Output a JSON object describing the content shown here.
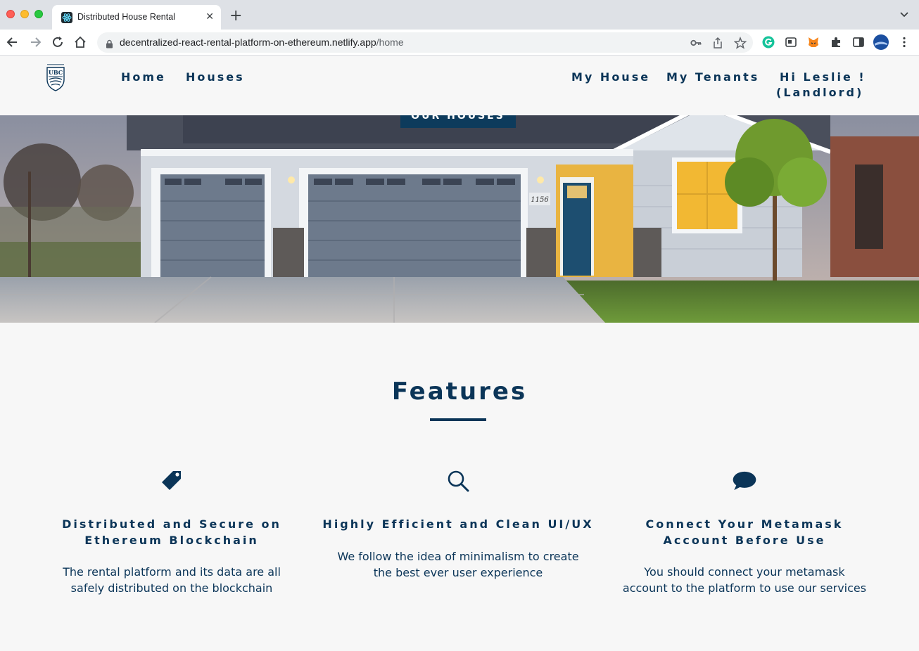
{
  "browser": {
    "tab_title": "Distributed House Rental",
    "tab_close": "✕",
    "new_tab": "+",
    "url_host": "decentralized-react-rental-platform-on-ethereum.netlify.app",
    "url_path": "/home"
  },
  "site": {
    "nav_left": [
      "Home",
      "Houses"
    ],
    "nav_right": [
      "My House",
      "My Tenants"
    ],
    "greeting_line1": "Hi Leslie !",
    "greeting_line2": "(Landlord)",
    "logo_text": "UBC"
  },
  "hero": {
    "button_label": "OUR HOUSES",
    "house_number": "1156"
  },
  "features": {
    "title": "Features",
    "items": [
      {
        "icon": "tag-icon",
        "title_line1": "Distributed and Secure on",
        "title_line2": "Ethereum Blockchain",
        "text_line1": "The rental platform and its data are all",
        "text_line2": "safely distributed on the blockchain"
      },
      {
        "icon": "search-icon",
        "title_line1": "Highly Efficient and Clean UI/UX",
        "title_line2": "",
        "text_line1": "We follow the idea of minimalism to create",
        "text_line2": "the best ever user experience"
      },
      {
        "icon": "speech-bubble-icon",
        "title_line1": "Connect Your Metamask",
        "title_line2": "Account Before Use",
        "text_line1": "You should connect your metamask",
        "text_line2": "account to the platform to use our services"
      }
    ]
  },
  "colors": {
    "brand_navy": "#0b3558",
    "button_navy": "#0d3b5c",
    "page_bg": "#f7f7f7"
  }
}
